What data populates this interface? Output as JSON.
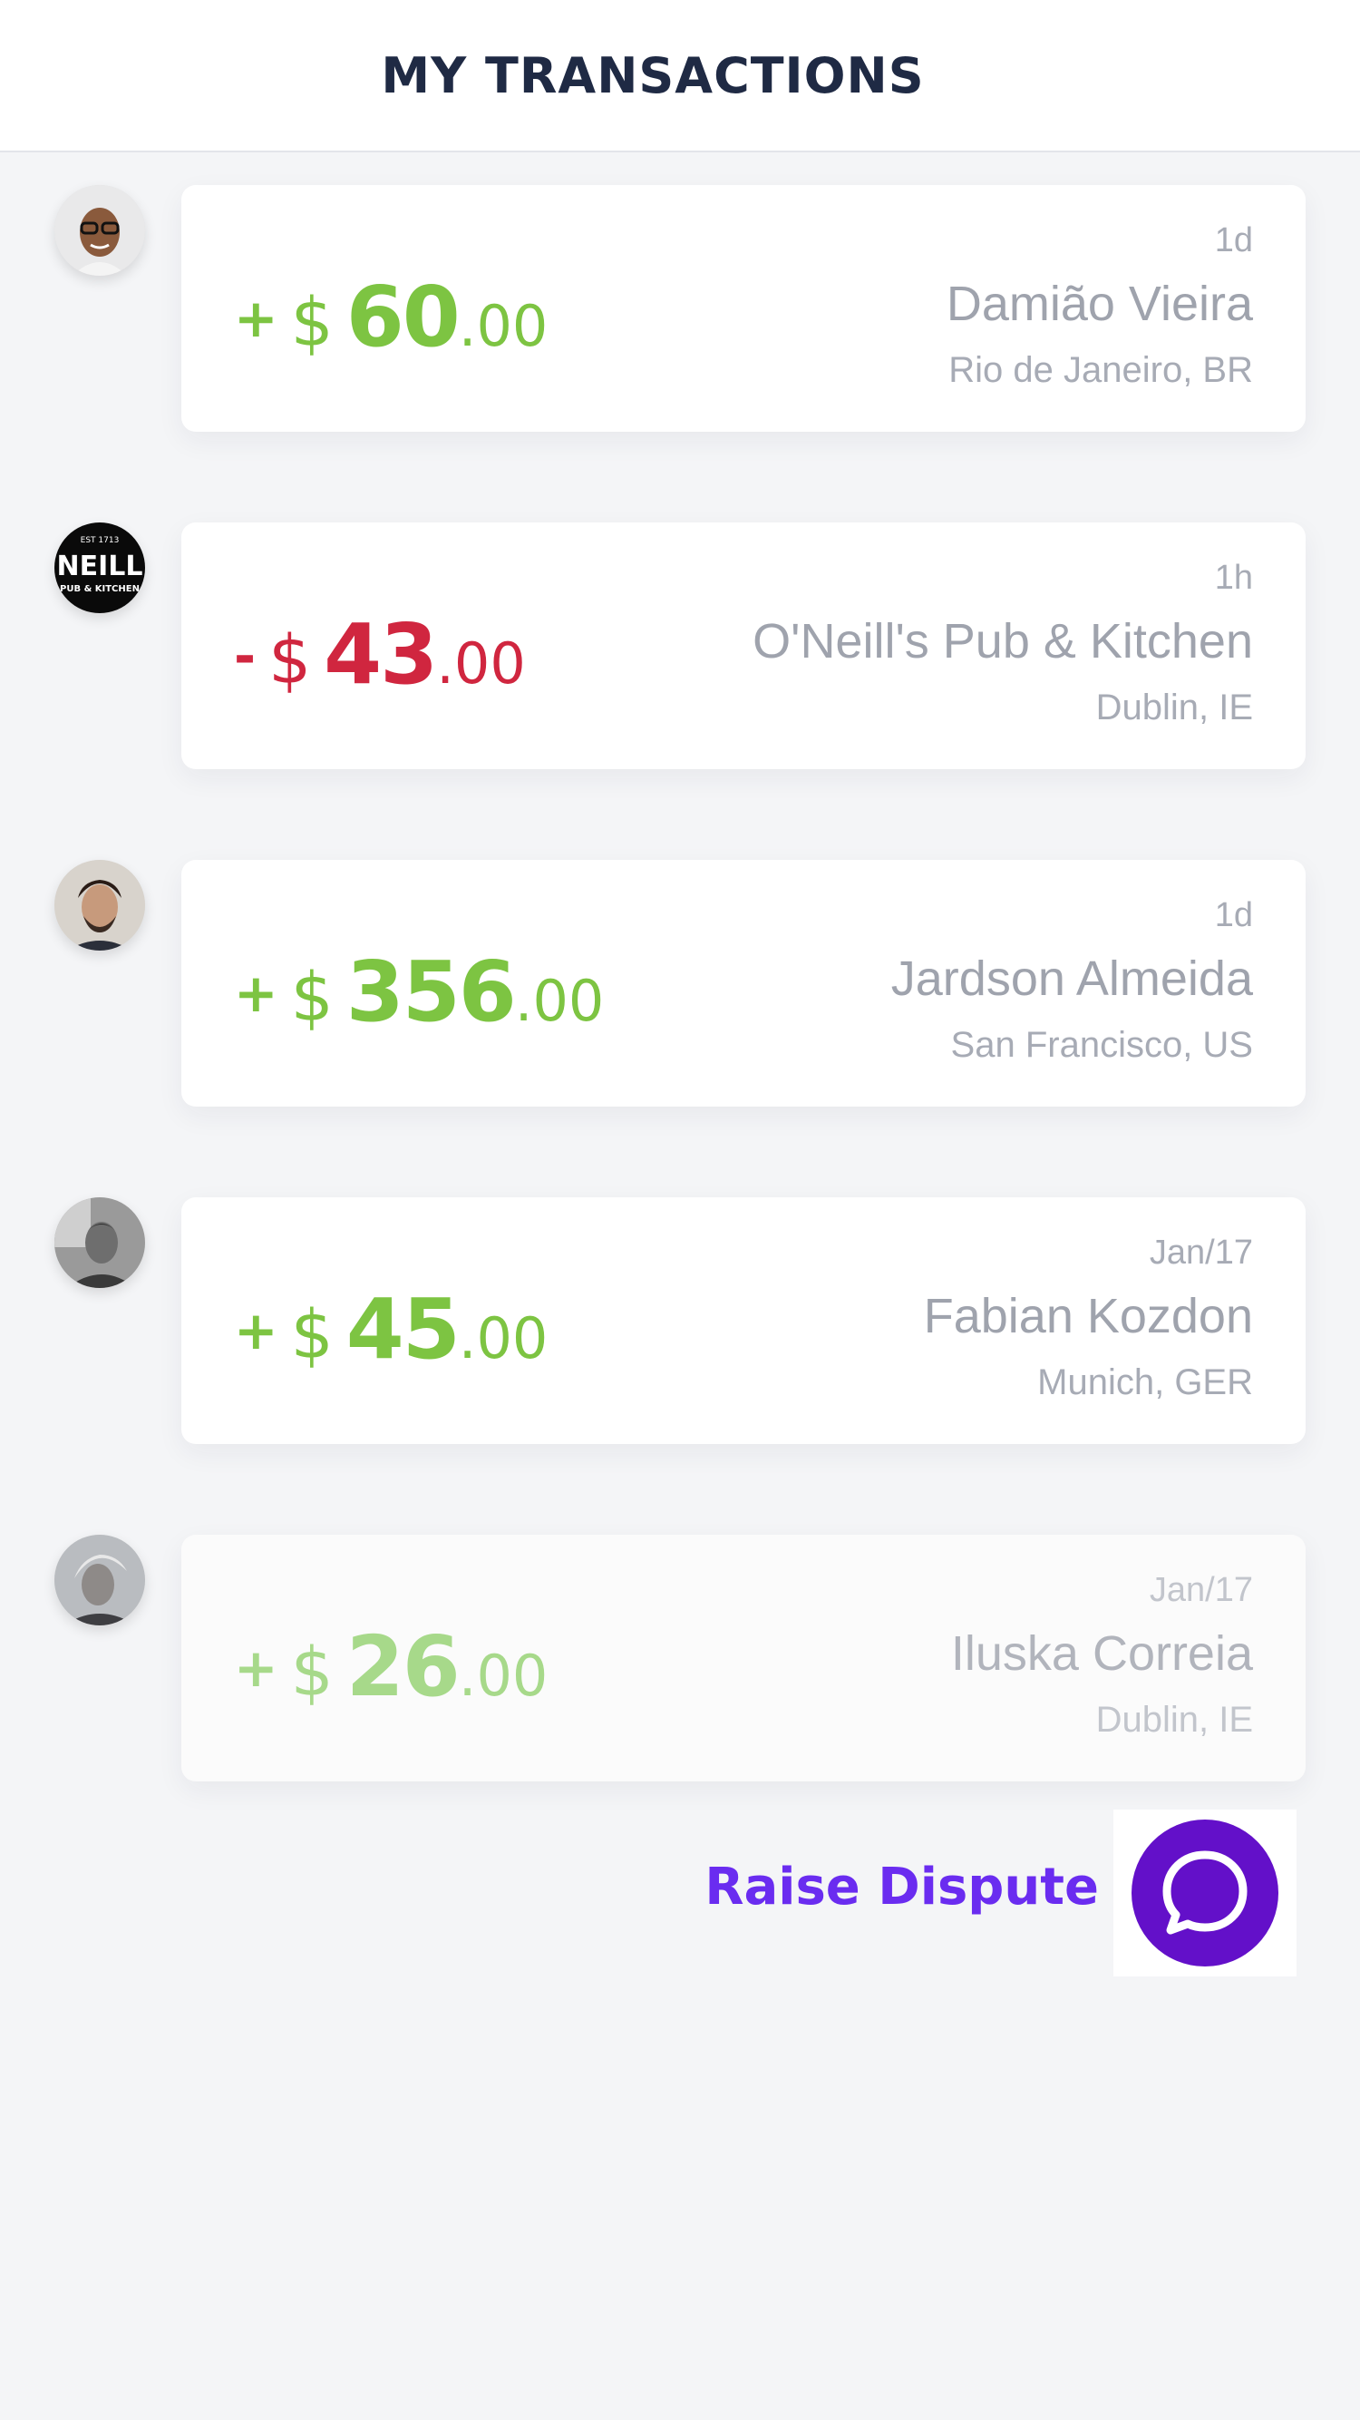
{
  "header": {
    "title": "MY TRANSACTIONS"
  },
  "transactions": [
    {
      "sign": "+",
      "currency": "$",
      "whole": "60",
      "cents": ".00",
      "type": "credit",
      "time": "1d",
      "name": "Damião Vieira",
      "location": "Rio de Janeiro, BR",
      "avatar_icon": "user-avatar-icon"
    },
    {
      "sign": "-",
      "currency": "$",
      "whole": "43",
      "cents": ".00",
      "type": "debit",
      "time": "1h",
      "name": "O'Neill's Pub & Kitchen",
      "location": "Dublin, IE",
      "avatar_icon": "pub-logo-icon",
      "avatar_text": {
        "top": "EST 1713",
        "main": "NEILL",
        "bottom": "PUB & KITCHEN"
      }
    },
    {
      "sign": "+",
      "currency": "$",
      "whole": "356",
      "cents": ".00",
      "type": "credit",
      "time": "1d",
      "name": "Jardson Almeida",
      "location": "San Francisco, US",
      "avatar_icon": "user-avatar-icon"
    },
    {
      "sign": "+",
      "currency": "$",
      "whole": "45",
      "cents": ".00",
      "type": "credit",
      "time": "Jan/17",
      "name": "Fabian Kozdon",
      "location": "Munich, GER",
      "avatar_icon": "user-avatar-icon"
    },
    {
      "sign": "+",
      "currency": "$",
      "whole": "26",
      "cents": ".00",
      "type": "credit",
      "time": "Jan/17",
      "name": "Iluska Correia",
      "location": "Dublin, IE",
      "avatar_icon": "user-avatar-icon",
      "faded": true
    }
  ],
  "dispute": {
    "label": "Raise Dispute",
    "icon": "chat-bubble-icon"
  },
  "colors": {
    "credit": "#7dc442",
    "debit": "#d0263f",
    "accent": "#6a2cf0",
    "chat_button": "#6310c9",
    "title": "#1f2a44"
  }
}
